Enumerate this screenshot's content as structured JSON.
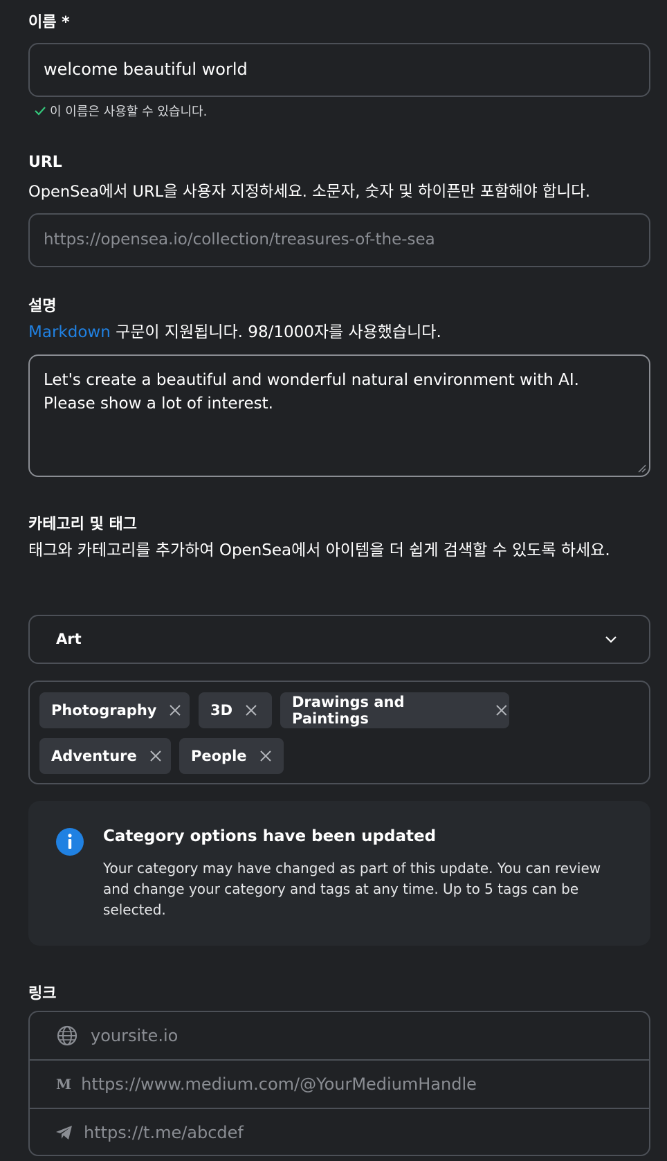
{
  "name": {
    "label": "이름 *",
    "value": "welcome beautiful world",
    "hint": "이 이름은 사용할 수 있습니다."
  },
  "url": {
    "label": "URL",
    "description": "OpenSea에서 URL을 사용자 지정하세요. 소문자, 숫자 및 하이픈만 포함해야 합니다.",
    "placeholder": "https://opensea.io/collection/treasures-of-the-sea"
  },
  "description": {
    "label": "설명",
    "markdown_link": "Markdown",
    "help_text": " 구문이 지원됩니다. 98/1000자를 사용했습니다.",
    "value": "Let's create a beautiful and wonderful natural environment with AI. Please show a lot of interest."
  },
  "category": {
    "label": "카테고리 및 태그",
    "description": "태그와 카테고리를 추가하여 OpenSea에서 아이템을 더 쉽게 검색할 수 있도록 하세요.",
    "selected": "Art",
    "tags": [
      "Photography",
      "3D",
      "Drawings and Paintings",
      "Adventure",
      "People"
    ]
  },
  "notice": {
    "title": "Category options have been updated",
    "body": "Your category may have changed as part of this update. You can review and change your category and tags at any time. Up to 5 tags can be selected.",
    "icon": "info-icon",
    "icon_color": "#2081e2"
  },
  "links": {
    "label": "링크",
    "items": [
      {
        "icon": "globe-icon",
        "placeholder": "yoursite.io"
      },
      {
        "icon": "medium-icon",
        "placeholder": "https://www.medium.com/@YourMediumHandle"
      },
      {
        "icon": "telegram-icon",
        "placeholder": "https://t.me/abcdef"
      }
    ]
  },
  "colors": {
    "background": "#202225",
    "border": "#4c5057",
    "link": "#2081e2",
    "success": "#34c77b"
  }
}
